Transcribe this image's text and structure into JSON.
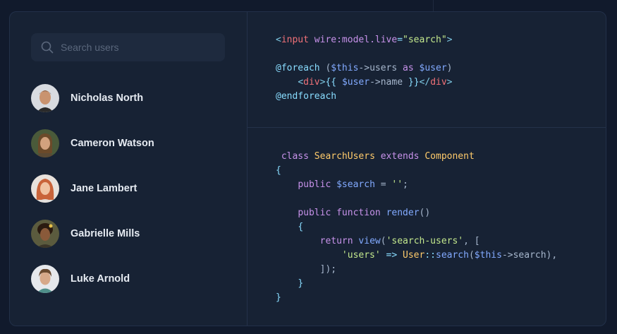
{
  "search": {
    "placeholder": "Search users",
    "value": ""
  },
  "users": [
    {
      "name": "Nicholas North"
    },
    {
      "name": "Cameron Watson"
    },
    {
      "name": "Jane Lambert"
    },
    {
      "name": "Gabrielle Mills"
    },
    {
      "name": "Luke Arnold"
    }
  ],
  "code_top": [
    [
      [
        "tag",
        "<"
      ],
      [
        "tagname",
        "input"
      ],
      [
        "plain",
        " "
      ],
      [
        "attr",
        "wire:model.live"
      ],
      [
        "punc",
        "="
      ],
      [
        "str",
        "\"search\""
      ],
      [
        "tag",
        ">"
      ]
    ],
    [],
    [
      [
        "dir",
        "@foreach"
      ],
      [
        "plain",
        " ("
      ],
      [
        "var",
        "$this"
      ],
      [
        "plain",
        "->users "
      ],
      [
        "kw",
        "as"
      ],
      [
        "plain",
        " "
      ],
      [
        "var",
        "$user"
      ],
      [
        "plain",
        ")"
      ]
    ],
    [
      [
        "plain",
        "    "
      ],
      [
        "tag",
        "<"
      ],
      [
        "tagname",
        "div"
      ],
      [
        "tag",
        ">"
      ],
      [
        "punc",
        "{{ "
      ],
      [
        "var",
        "$user"
      ],
      [
        "plain",
        "->name "
      ],
      [
        "punc",
        "}}"
      ],
      [
        "tag",
        "</"
      ],
      [
        "tagname",
        "div"
      ],
      [
        "tag",
        ">"
      ]
    ],
    [
      [
        "dir",
        "@endforeach"
      ]
    ]
  ],
  "code_bottom": [
    [
      [
        "plain",
        " "
      ],
      [
        "kw",
        "class"
      ],
      [
        "plain",
        " "
      ],
      [
        "cls",
        "SearchUsers"
      ],
      [
        "plain",
        " "
      ],
      [
        "kw",
        "extends"
      ],
      [
        "plain",
        " "
      ],
      [
        "cls",
        "Component"
      ]
    ],
    [
      [
        "punc",
        "{"
      ]
    ],
    [
      [
        "plain",
        "    "
      ],
      [
        "kw",
        "public"
      ],
      [
        "plain",
        " "
      ],
      [
        "var",
        "$search"
      ],
      [
        "plain",
        " = "
      ],
      [
        "str",
        "''"
      ],
      [
        "plain",
        ";"
      ]
    ],
    [],
    [
      [
        "plain",
        "    "
      ],
      [
        "kw",
        "public"
      ],
      [
        "plain",
        " "
      ],
      [
        "kw",
        "function"
      ],
      [
        "plain",
        " "
      ],
      [
        "fn",
        "render"
      ],
      [
        "plain",
        "()"
      ]
    ],
    [
      [
        "plain",
        "    "
      ],
      [
        "punc",
        "{"
      ]
    ],
    [
      [
        "plain",
        "        "
      ],
      [
        "kw",
        "return"
      ],
      [
        "plain",
        " "
      ],
      [
        "fn",
        "view"
      ],
      [
        "plain",
        "("
      ],
      [
        "str",
        "'search-users'"
      ],
      [
        "plain",
        ", ["
      ]
    ],
    [
      [
        "plain",
        "            "
      ],
      [
        "str",
        "'users'"
      ],
      [
        "plain",
        " "
      ],
      [
        "punc",
        "=>"
      ],
      [
        "plain",
        " "
      ],
      [
        "cls",
        "User"
      ],
      [
        "punc",
        "::"
      ],
      [
        "fn",
        "search"
      ],
      [
        "plain",
        "("
      ],
      [
        "var",
        "$this"
      ],
      [
        "plain",
        "->search),"
      ]
    ],
    [
      [
        "plain",
        "        ]);"
      ]
    ],
    [
      [
        "plain",
        "    "
      ],
      [
        "punc",
        "}"
      ]
    ],
    [
      [
        "punc",
        "}"
      ]
    ]
  ],
  "colors": {
    "background": "#111a2c",
    "card": "#172234",
    "accent_text": "#e6ebf2"
  },
  "icons": {
    "search": "search-icon"
  }
}
